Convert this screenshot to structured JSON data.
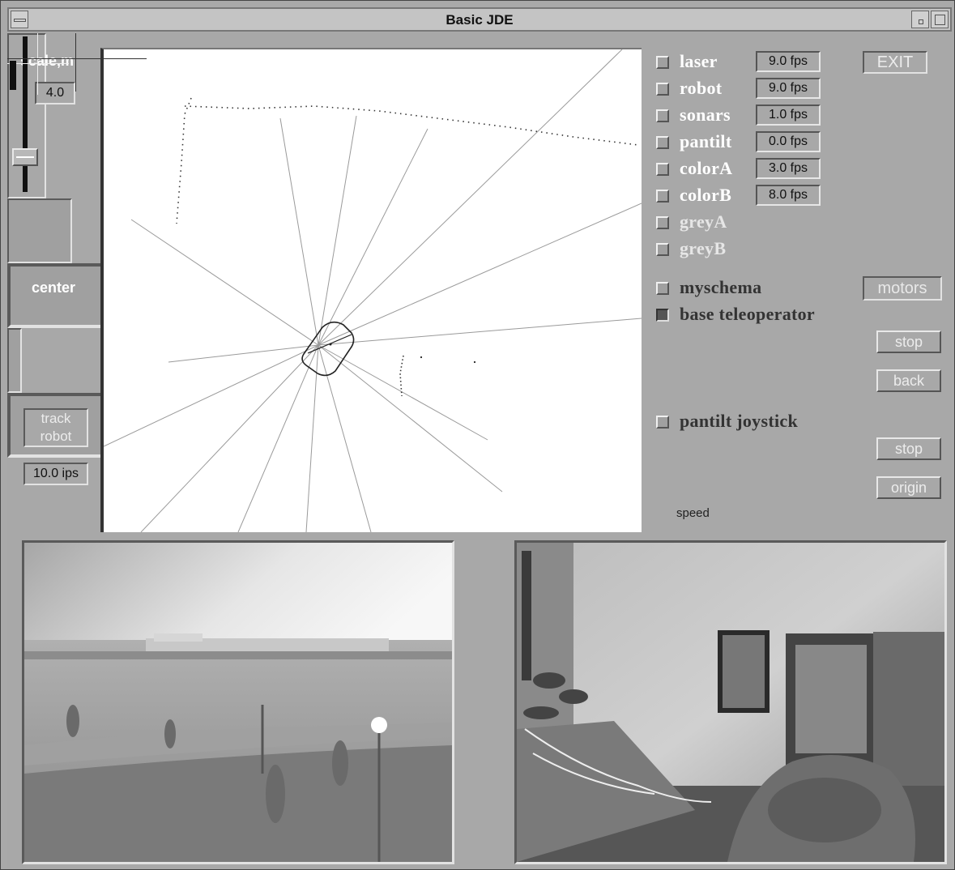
{
  "window": {
    "title": "Basic JDE"
  },
  "left_panel": {
    "scale_label": "scale,m",
    "scale_value": "4.0",
    "center_label": "center",
    "track_robot_label": "track\nrobot",
    "ips_value": "10.0 ips"
  },
  "schemas": [
    {
      "name": "laser",
      "fps": "9.0 fps",
      "checked": false
    },
    {
      "name": "robot",
      "fps": "9.0 fps",
      "checked": false
    },
    {
      "name": "sonars",
      "fps": "1.0 fps",
      "checked": false
    },
    {
      "name": "pantilt",
      "fps": "0.0 fps",
      "checked": false
    },
    {
      "name": "colorA",
      "fps": "3.0 fps",
      "checked": false
    },
    {
      "name": "colorB",
      "fps": "8.0 fps",
      "checked": false
    },
    {
      "name": "greyA",
      "checked": false
    },
    {
      "name": "greyB",
      "checked": false
    }
  ],
  "exit_label": "EXIT",
  "myschema_label": "myschema",
  "motors_label": "motors",
  "base_teleoperator": {
    "label": "base teleoperator",
    "checked": true,
    "stop_label": "stop",
    "back_label": "back"
  },
  "pantilt_joystick": {
    "label": "pantilt joystick",
    "checked": false,
    "stop_label": "stop",
    "origin_label": "origin",
    "speed_label": "speed"
  },
  "colors": {
    "background": "#a8a8a8",
    "map_bg": "#ffffff",
    "checked": "#555555"
  }
}
